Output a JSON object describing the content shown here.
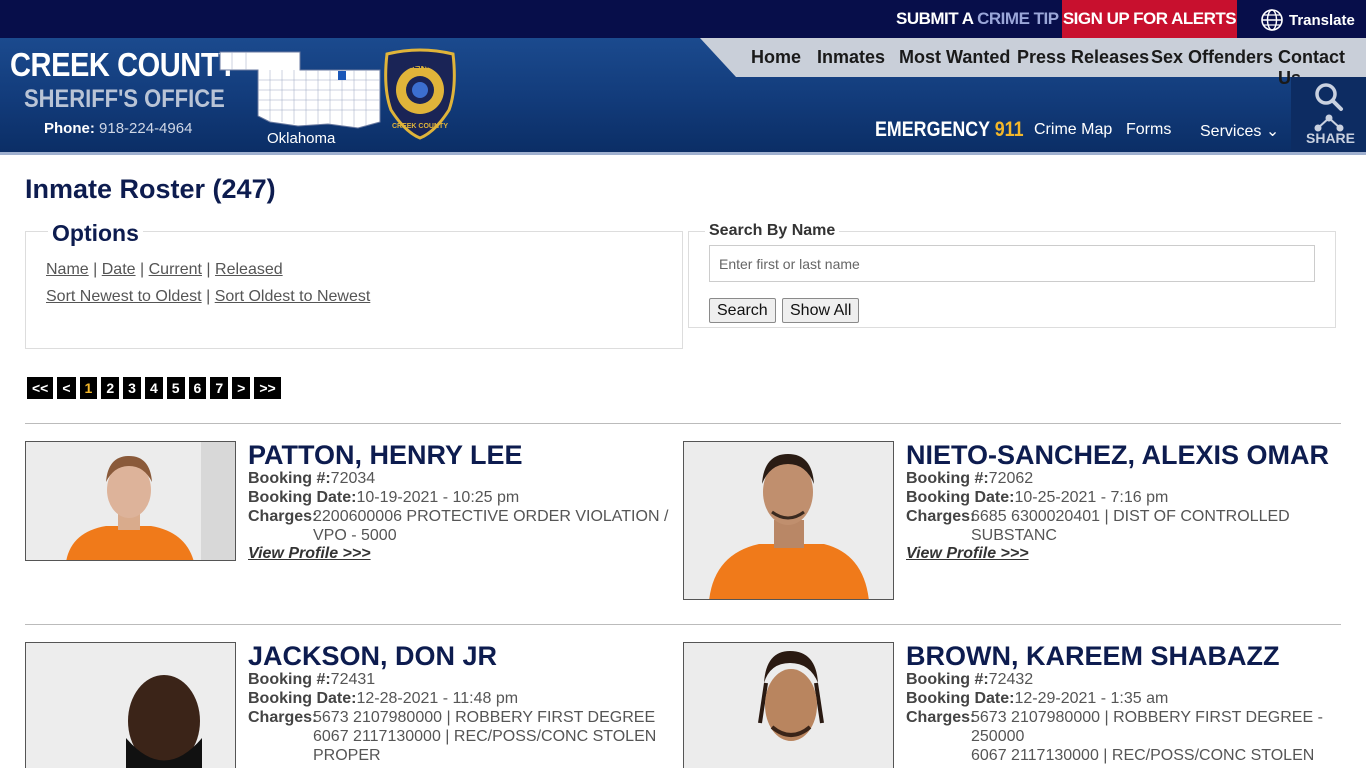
{
  "topbar": {
    "tip_part1": "SUBMIT A ",
    "tip_part2": "CRIME TIP",
    "tip_arrow": "❯",
    "alerts_label": "SIGN UP FOR ALERTS",
    "alerts_arrow": "❯",
    "translate_label": "Translate"
  },
  "brand": {
    "name": "CREEK COUNTY",
    "office": "SHERIFF'S OFFICE",
    "phone_label": "Phone:",
    "phone_number": "918-224-4964",
    "state_label": "Oklahoma",
    "badge_top": "SHERIFF",
    "badge_bottom": "CREEK COUNTY"
  },
  "nav": [
    "Home",
    "Inmates",
    "Most Wanted",
    "Press Releases",
    "Sex Offenders",
    "Contact Us"
  ],
  "subnav": {
    "emergency_label": "EMERGENCY",
    "emergency_number": "911",
    "links": [
      "Crime Map",
      "Forms",
      "Services"
    ],
    "services_chevron": "⌄",
    "share_label": "SHARE"
  },
  "page": {
    "title": "Inmate Roster (247)"
  },
  "options": {
    "title": "Options",
    "sort_by": [
      "Name",
      "Date",
      "Current",
      "Released"
    ],
    "sort_order": [
      "Sort Newest to Oldest",
      "Sort Oldest to Newest"
    ],
    "separator": "|"
  },
  "search": {
    "title": "Search By Name",
    "placeholder": "Enter first or last name",
    "value": "",
    "search_button": "Search",
    "show_all_button": "Show All"
  },
  "pager": {
    "first": "<<",
    "prev": "<",
    "pages": [
      "1",
      "2",
      "3",
      "4",
      "5",
      "6",
      "7"
    ],
    "current": "1",
    "next": ">",
    "last": ">>"
  },
  "labels": {
    "booking_no": "Booking #:",
    "booking_date": "Booking Date:",
    "charges": "Charges:",
    "view_profile": "View Profile >>>"
  },
  "inmates": [
    {
      "name": "PATTON, HENRY LEE",
      "booking_no": "72034",
      "booking_date": "10-19-2021 - 10:25 pm",
      "charges": [
        "2200600006 PROTECTIVE ORDER VIOLATION /",
        "VPO - 5000"
      ]
    },
    {
      "name": "NIETO-SANCHEZ, ALEXIS OMAR",
      "booking_no": "72062",
      "booking_date": "10-25-2021 - 7:16 pm",
      "charges": [
        "6685 6300020401 | DIST OF CONTROLLED",
        "SUBSTANC"
      ]
    },
    {
      "name": "JACKSON, DON JR",
      "booking_no": "72431",
      "booking_date": "12-28-2021 - 11:48 pm",
      "charges": [
        "5673 2107980000 | ROBBERY FIRST DEGREE",
        "6067 2117130000 | REC/POSS/CONC STOLEN",
        "PROPER"
      ]
    },
    {
      "name": "BROWN, KAREEM SHABAZZ",
      "booking_no": "72432",
      "booking_date": "12-29-2021 - 1:35 am",
      "charges": [
        "5673 2107980000 | ROBBERY FIRST DEGREE -",
        "250000",
        "6067 2117130000 | REC/POSS/CONC STOLEN"
      ]
    }
  ]
}
